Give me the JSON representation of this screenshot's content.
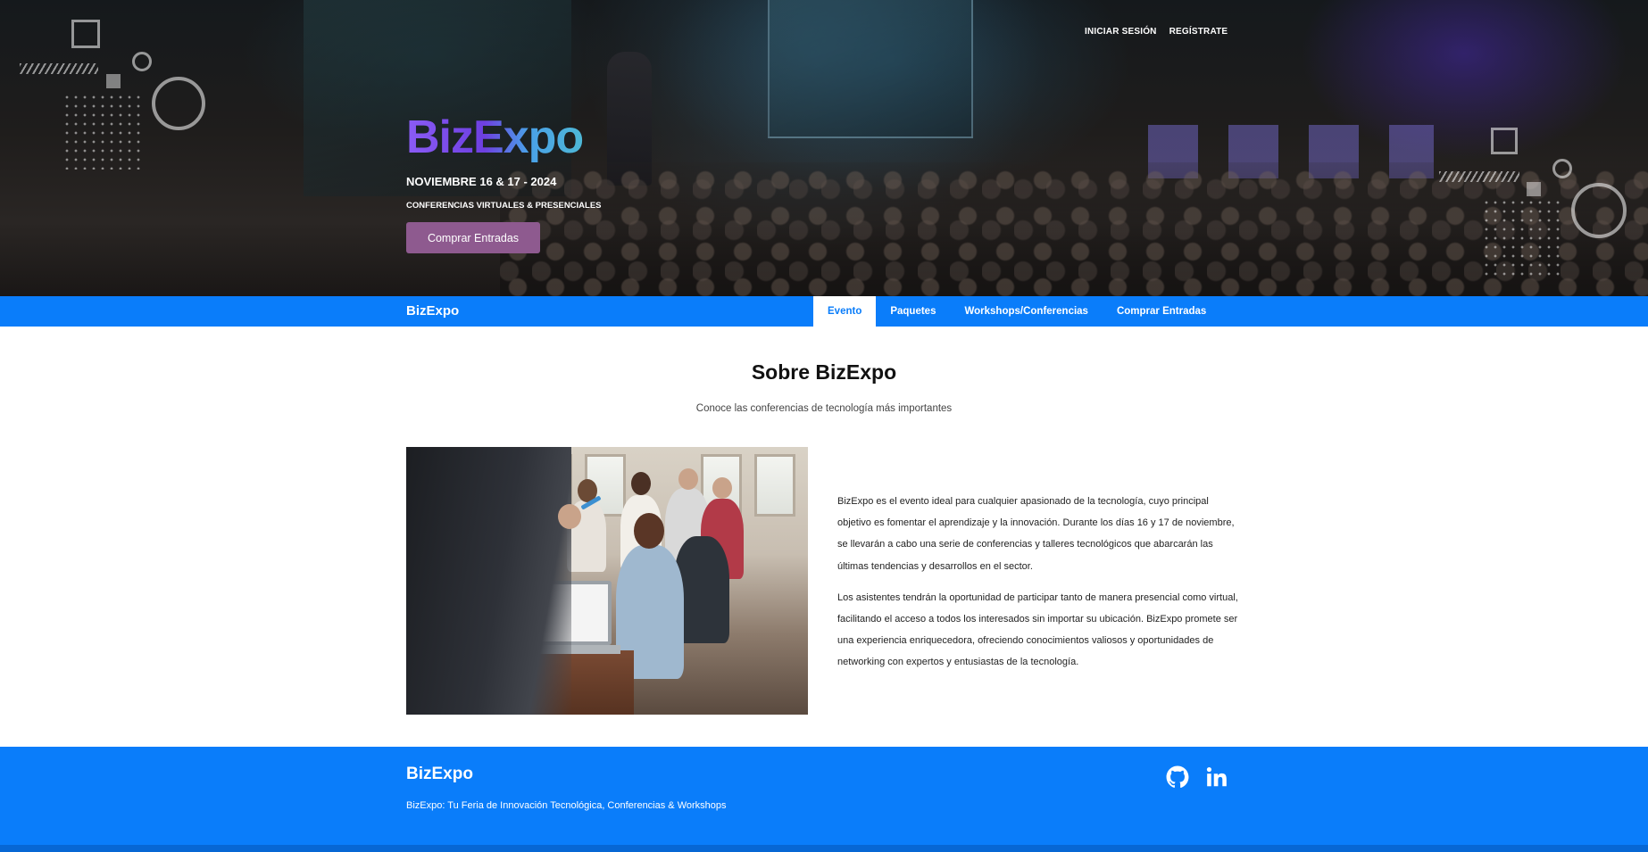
{
  "header": {
    "links": {
      "login": "INICIAR SESIÓN",
      "register": "REGÍSTRATE"
    },
    "brand": {
      "part1": "Biz",
      "part2": "E",
      "part3": "xpo"
    },
    "date": "NOVIEMBRE 16 & 17 - 2024",
    "subtitle": "CONFERENCIAS VIRTUALES & PRESENCIALES",
    "cta_label": "Comprar Entradas"
  },
  "nav": {
    "brand": "BizExpo",
    "items": [
      {
        "label": "Evento",
        "active": true
      },
      {
        "label": "Paquetes",
        "active": false
      },
      {
        "label": "Workshops/Conferencias",
        "active": false
      },
      {
        "label": "Comprar Entradas",
        "active": false
      }
    ]
  },
  "about": {
    "title": "Sobre BizExpo",
    "subtitle": "Conoce las conferencias de tecnología más importantes",
    "paragraphs": [
      "BizExpo es el evento ideal para cualquier apasionado de la tecnología, cuyo principal objetivo es fomentar el aprendizaje y la innovación. Durante los días 16 y 17 de noviembre, se llevarán a cabo una serie de conferencias y talleres tecnológicos que abarcarán las últimas tendencias y desarrollos en el sector.",
      "Los asistentes tendrán la oportunidad de participar tanto de manera presencial como virtual, facilitando el acceso a todos los interesados sin importar su ubicación. BizExpo promete ser una experiencia enriquecedora, ofreciendo conocimientos valiosos y oportunidades de networking con expertos y entusiastas de la tecnología."
    ]
  },
  "footer": {
    "brand": "BizExpo",
    "tagline": "BizExpo: Tu Feria de Innovación Tecnológica, Conferencias & Workshops",
    "social": [
      "github-icon",
      "linkedin-icon"
    ]
  },
  "colors": {
    "primary_blue": "#0a7dfa",
    "cta_purple": "#8e5a8f",
    "brand_gradient_start": "#8b5cf6",
    "brand_gradient_end": "#4fc0d0"
  }
}
